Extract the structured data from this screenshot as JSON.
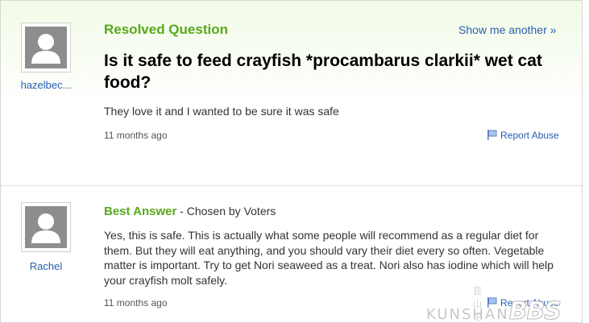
{
  "question": {
    "status_label": "Resolved Question",
    "show_another": "Show me another »",
    "asker": "hazelbec...",
    "title": "Is it safe to feed crayfish *procambarus clarkii* wet cat food?",
    "body": "They love it and I wanted to be sure it was safe",
    "time": "11 months ago",
    "report_label": "Report Abuse"
  },
  "answer": {
    "label": "Best Answer",
    "chosen_by": " - Chosen by Voters",
    "answerer": "Rachel",
    "body": "Yes, this is safe. This is actually what some people will recommend as a regular diet for them. But they will eat anything, and you should vary their diet every so often. Vegetable matter is important. Try to get Nori seaweed as a treat. Nori also has iodine which will help your crayfish molt safely.",
    "time": "11 months ago",
    "report_label": "Report Abuse"
  },
  "watermark": {
    "small": "昆山论坛",
    "main": "KUNSHAN",
    "big": "BBS"
  },
  "colors": {
    "accent_green": "#58a81d",
    "link_blue": "#2a5db0"
  },
  "icons": [
    "user-avatar-icon",
    "flag-icon"
  ]
}
